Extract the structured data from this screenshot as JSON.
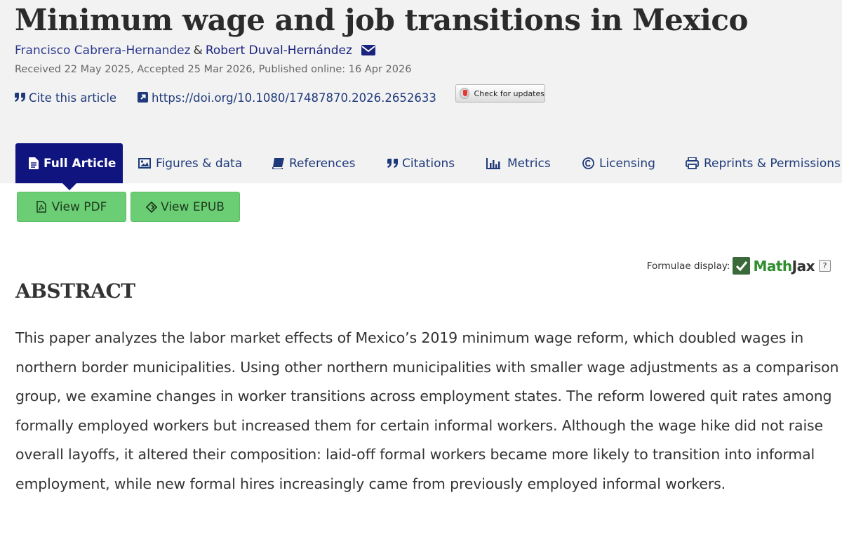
{
  "article": {
    "title": "Minimum wage and job transitions in Mexico",
    "author1": "Francisco Cabrera-Hernandez",
    "author_separator": "&",
    "author2": "Robert Duval-Hernández",
    "dates": "Received 22 May 2025, Accepted 25 Mar 2026, Published online: 16 Apr 2026",
    "cite_label": "Cite this article",
    "doi": "https://doi.org/10.1080/17487870.2026.2652633",
    "check_updates_label": "Check for updates"
  },
  "tabs": [
    {
      "label": "Full Article",
      "icon": "file-icon",
      "active": true
    },
    {
      "label": "Figures & data",
      "icon": "image-icon"
    },
    {
      "label": "References",
      "icon": "book-icon"
    },
    {
      "label": "Citations",
      "icon": "quote-icon"
    },
    {
      "label": "Metrics",
      "icon": "bar-chart-icon"
    },
    {
      "label": "Licensing",
      "icon": "copyright-icon"
    },
    {
      "label": "Reprints & Permissions",
      "icon": "print-icon"
    }
  ],
  "actions": {
    "view_pdf": "View PDF",
    "view_epub": "View EPUB"
  },
  "formulae": {
    "label": "Formulae display:",
    "logo_math": "Math",
    "logo_jax": "Jax",
    "help": "?"
  },
  "abstract": {
    "heading": "ABSTRACT",
    "text": "This paper analyzes the labor market effects of Mexico’s 2019 minimum wage reform, which doubled wages in northern border municipalities. Using other northern municipalities with smaller wage adjustments as a comparison group, we examine changes in worker transitions across employment states. The reform lowered quit rates among formally employed workers but increased them for certain informal workers. Although the wage hike did not raise overall layoffs, it altered their composition: laid-off formal workers became more likely to transition into informal employment, while new formal hires increasingly came from previously employed informal workers."
  },
  "colors": {
    "header_bg": "#f2f2f2",
    "active_tab": "#10147e",
    "link": "#1f3a7a",
    "green_button": "#6cce74"
  }
}
